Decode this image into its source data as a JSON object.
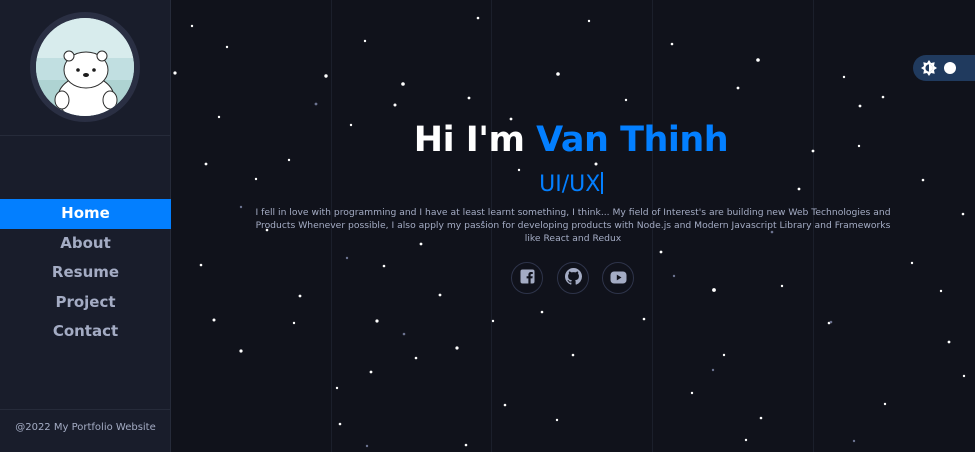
{
  "sidebar": {
    "avatar_alt": "polar bear avatar",
    "nav": [
      {
        "label": "Home",
        "active": true
      },
      {
        "label": "About",
        "active": false
      },
      {
        "label": "Resume",
        "active": false
      },
      {
        "label": "Project",
        "active": false
      },
      {
        "label": "Contact",
        "active": false
      }
    ],
    "footer": "@2022 My Portfolio Website"
  },
  "hero": {
    "greeting": "Hi I'm ",
    "name": "Van Thinh",
    "role": "UI/UX",
    "bio": "I fell in love with programming and I have at least learnt something, I think... My field of Interest's are building new Web Technologies and Products Whenever possible, I also apply my passion for developing products with Node.js and Modern Javascript Library and Frameworks like React and Redux",
    "socials": [
      {
        "icon": "facebook-icon"
      },
      {
        "icon": "github-icon"
      },
      {
        "icon": "youtube-icon"
      }
    ]
  },
  "theme_toggle": {
    "sun_icon": "sun-icon",
    "mode": "dark"
  },
  "colors": {
    "accent": "#037fff",
    "sidebar_bg": "#191d2b",
    "main_bg": "#10121b",
    "muted_text": "#a4acc4"
  }
}
